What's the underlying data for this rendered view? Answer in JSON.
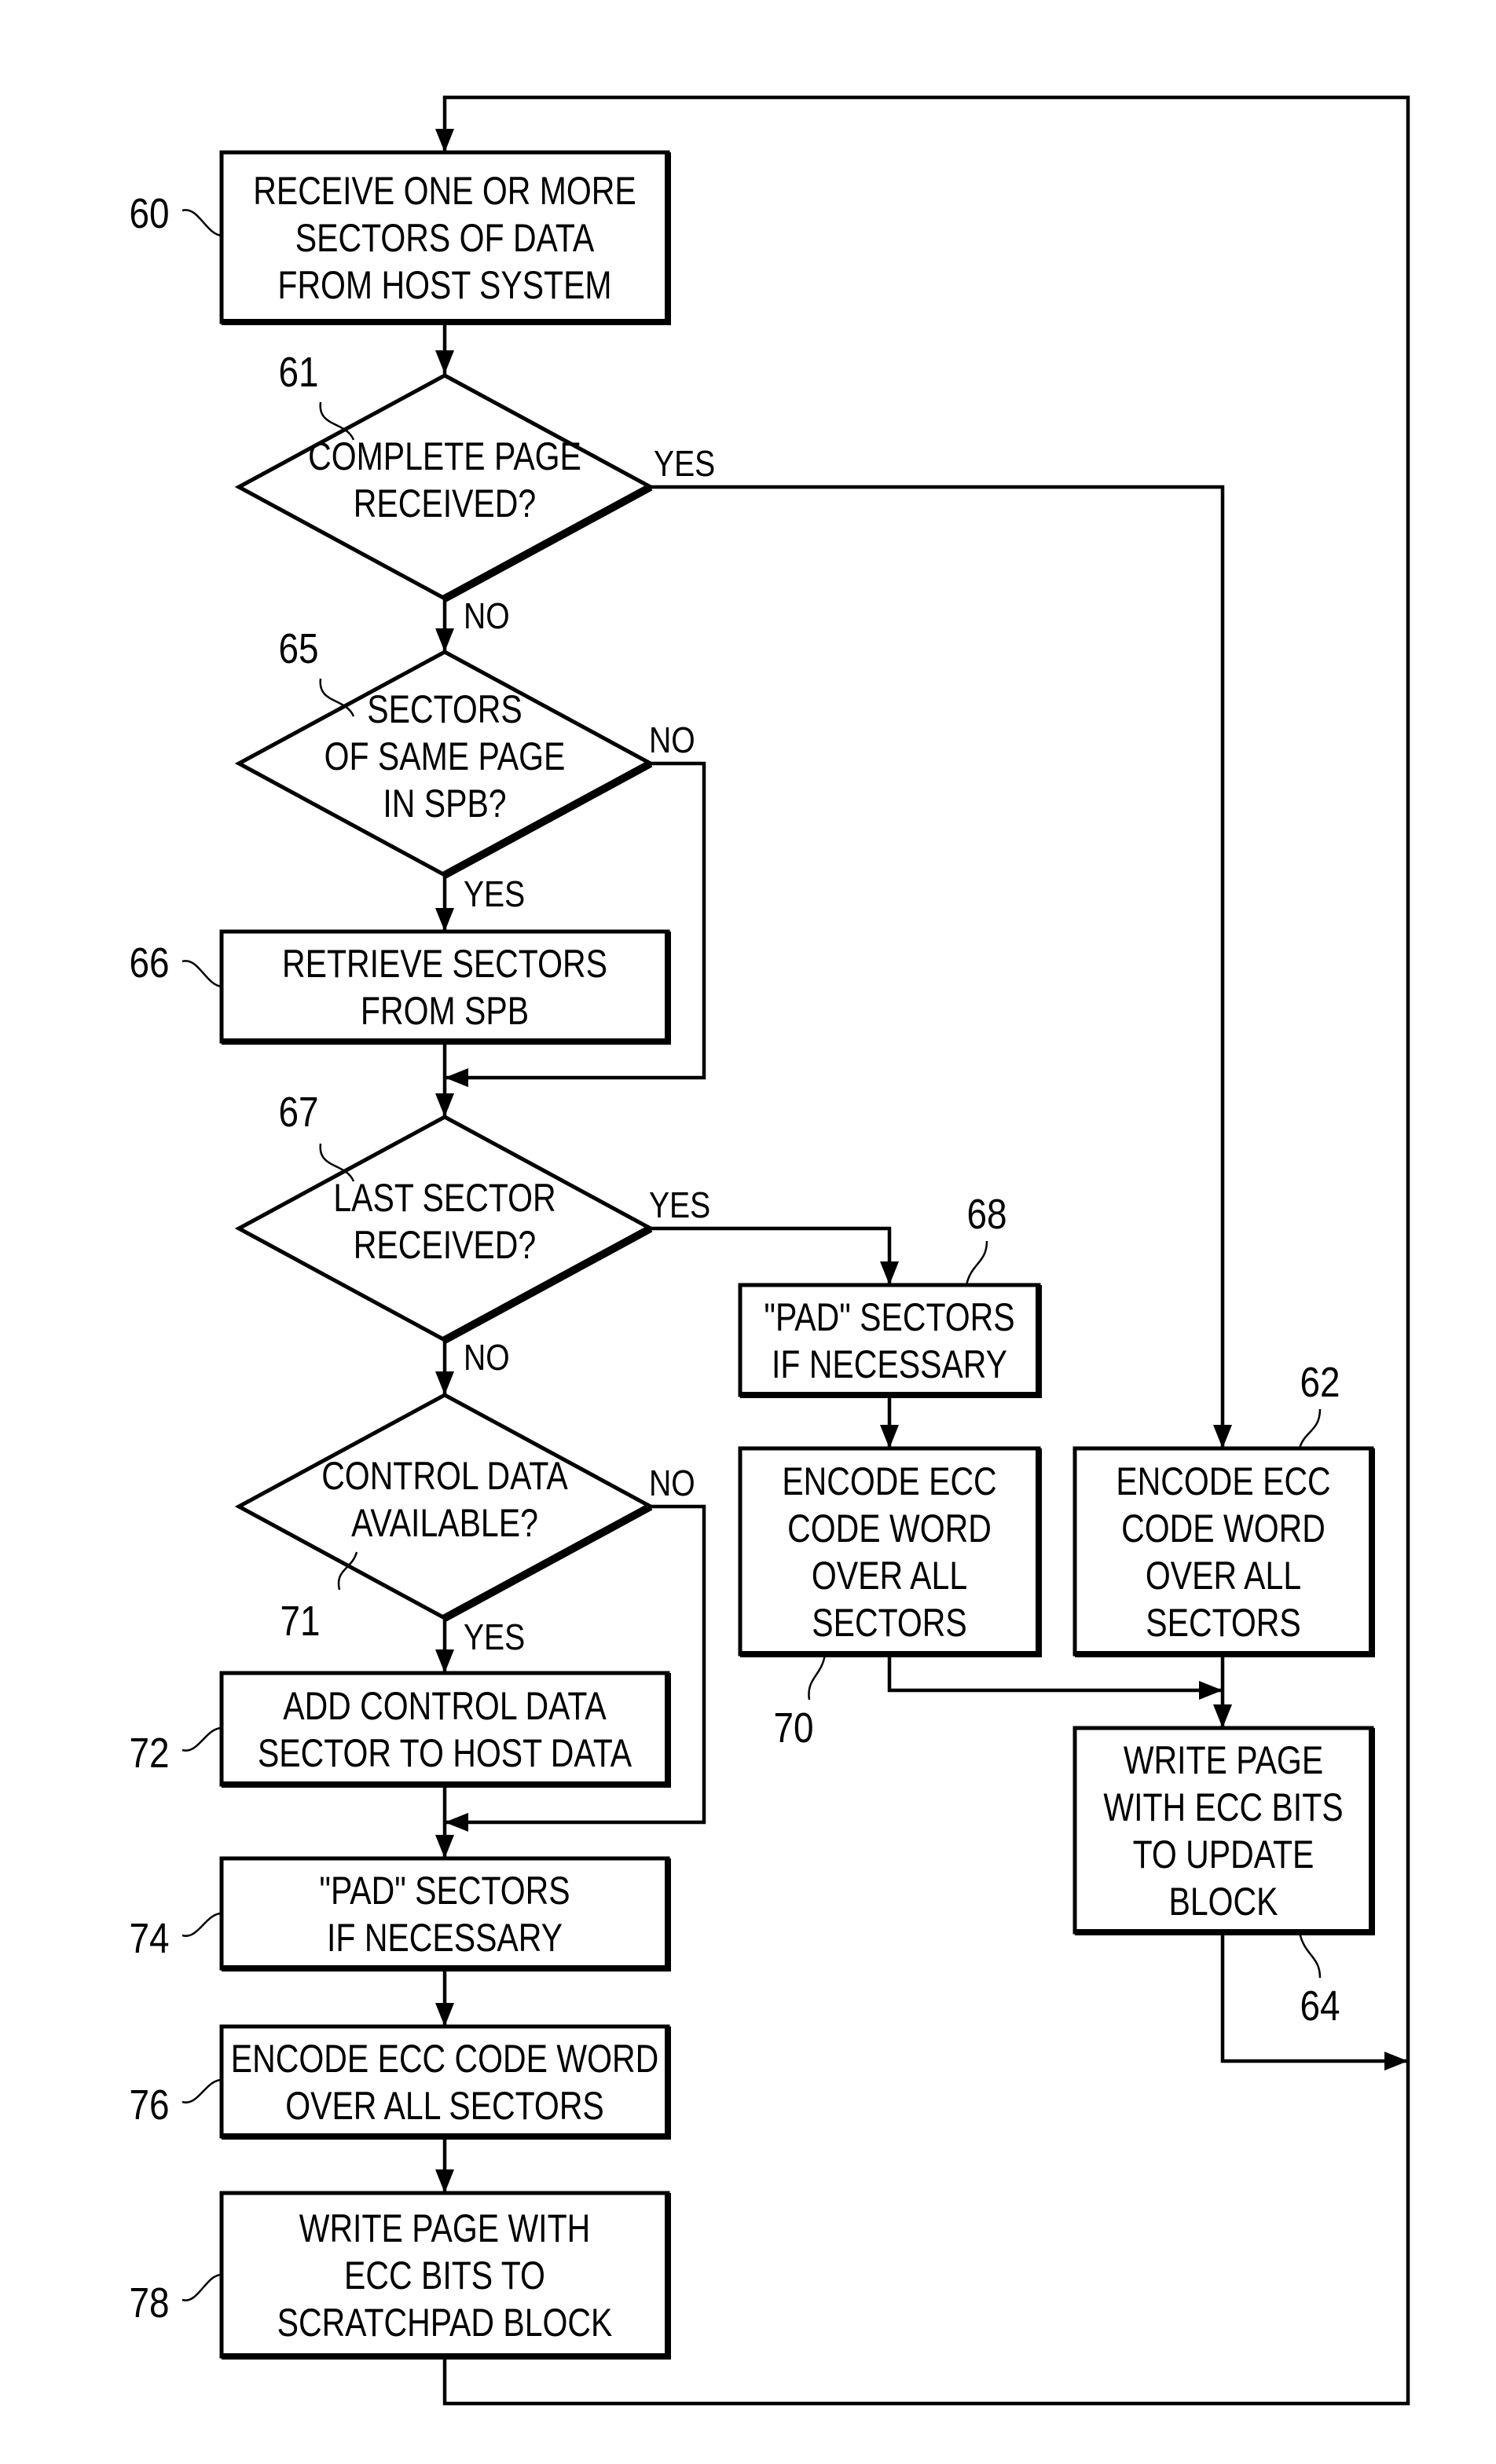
{
  "figure": {
    "type": "flowchart",
    "nodes": [
      {
        "id": "60",
        "kind": "process",
        "ref": "60",
        "lines": [
          "RECEIVE ONE OR MORE",
          "SECTORS OF DATA",
          "FROM HOST SYSTEM"
        ]
      },
      {
        "id": "61",
        "kind": "decision",
        "ref": "61",
        "lines": [
          "COMPLETE PAGE",
          "RECEIVED?"
        ]
      },
      {
        "id": "65",
        "kind": "decision",
        "ref": "65",
        "lines": [
          "SECTORS",
          "OF SAME PAGE",
          "IN SPB?"
        ]
      },
      {
        "id": "66",
        "kind": "process",
        "ref": "66",
        "lines": [
          "RETRIEVE SECTORS",
          "FROM SPB"
        ]
      },
      {
        "id": "67",
        "kind": "decision",
        "ref": "67",
        "lines": [
          "LAST SECTOR",
          "RECEIVED?"
        ]
      },
      {
        "id": "71",
        "kind": "decision",
        "ref": "71",
        "lines": [
          "CONTROL DATA",
          "AVAILABLE?"
        ]
      },
      {
        "id": "72",
        "kind": "process",
        "ref": "72",
        "lines": [
          "ADD CONTROL DATA",
          "SECTOR TO HOST DATA"
        ]
      },
      {
        "id": "74",
        "kind": "process",
        "ref": "74",
        "lines": [
          "\"PAD\" SECTORS",
          "IF NECESSARY"
        ]
      },
      {
        "id": "76",
        "kind": "process",
        "ref": "76",
        "lines": [
          "ENCODE ECC CODE WORD",
          "OVER ALL SECTORS"
        ]
      },
      {
        "id": "78",
        "kind": "process",
        "ref": "78",
        "lines": [
          "WRITE PAGE WITH",
          "ECC BITS TO",
          "SCRATCHPAD BLOCK"
        ]
      },
      {
        "id": "68",
        "kind": "process",
        "ref": "68",
        "lines": [
          "\"PAD\" SECTORS",
          "IF NECESSARY"
        ]
      },
      {
        "id": "70",
        "kind": "process",
        "ref": "70",
        "lines": [
          "ENCODE ECC",
          "CODE WORD",
          "OVER ALL",
          "SECTORS"
        ]
      },
      {
        "id": "62",
        "kind": "process",
        "ref": "62",
        "lines": [
          "ENCODE ECC",
          "CODE WORD",
          "OVER ALL",
          "SECTORS"
        ]
      },
      {
        "id": "64",
        "kind": "process",
        "ref": "64",
        "lines": [
          "WRITE PAGE",
          "WITH ECC BITS",
          "TO UPDATE",
          "BLOCK"
        ]
      }
    ],
    "edges": [
      {
        "from": "60",
        "to": "61",
        "label": ""
      },
      {
        "from": "61",
        "to": "62",
        "label": "YES"
      },
      {
        "from": "61",
        "to": "65",
        "label": "NO"
      },
      {
        "from": "65",
        "to": "66",
        "label": "YES"
      },
      {
        "from": "65",
        "to": "67",
        "label": "NO"
      },
      {
        "from": "66",
        "to": "67",
        "label": ""
      },
      {
        "from": "67",
        "to": "68",
        "label": "YES"
      },
      {
        "from": "67",
        "to": "71",
        "label": "NO"
      },
      {
        "from": "71",
        "to": "72",
        "label": "YES"
      },
      {
        "from": "71",
        "to": "74",
        "label": "NO"
      },
      {
        "from": "72",
        "to": "74",
        "label": ""
      },
      {
        "from": "74",
        "to": "76",
        "label": ""
      },
      {
        "from": "76",
        "to": "78",
        "label": ""
      },
      {
        "from": "78",
        "to": "60",
        "label": ""
      },
      {
        "from": "68",
        "to": "70",
        "label": ""
      },
      {
        "from": "70",
        "to": "64",
        "label": ""
      },
      {
        "from": "62",
        "to": "64",
        "label": ""
      },
      {
        "from": "64",
        "to": "60",
        "label": ""
      }
    ]
  }
}
